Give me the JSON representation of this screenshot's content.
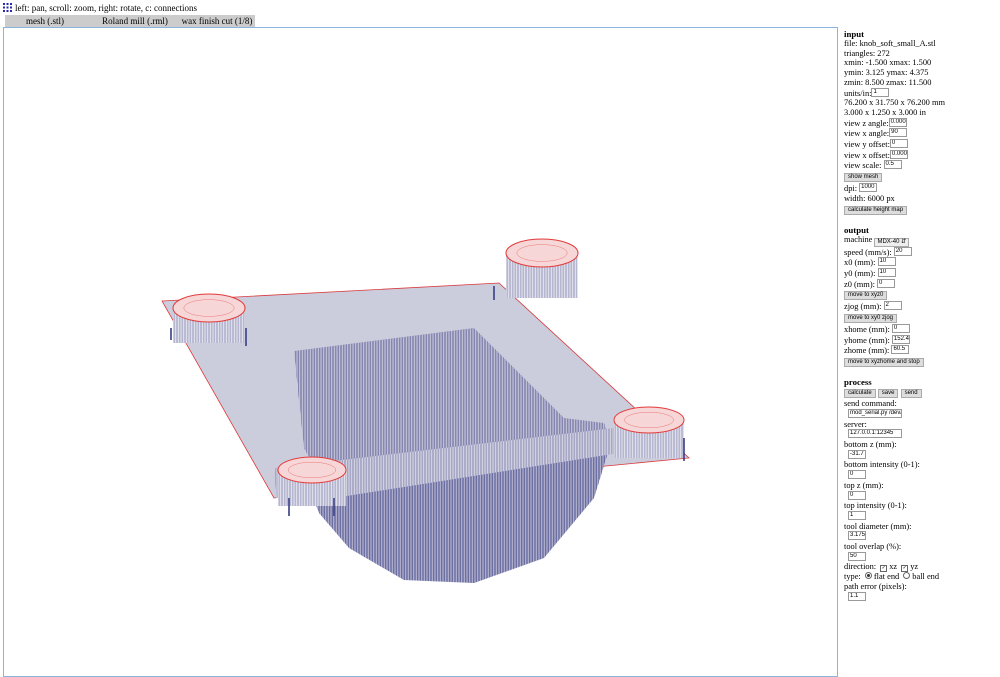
{
  "help": "left: pan, scroll: zoom, right: rotate, c: connections",
  "tabs": [
    "mesh (.stl)",
    "Roland mill (.rml)",
    "wax finish cut (1/8)"
  ],
  "input": {
    "title": "input",
    "file": "file: knob_soft_small_A.stl",
    "triangles": "triangles: 272",
    "xrange": "xmin: -1.500 xmax: 1.500",
    "yrange": "ymin: 3.125 ymax: 4.375",
    "zrange": "zmin: 8.500 zmax: 11.500",
    "units_label": "units/in:",
    "units_value": "1",
    "size_mm": "76.200 x 31.750 x 76.200 mm",
    "size_in": "3.000 x 1.250 x 3.000 in",
    "view_z_label": "view z angle:",
    "view_z": "0.000",
    "view_x_label": "view x angle:",
    "view_x": "90",
    "view_y_off_label": "view y offset:",
    "view_y_off": "0",
    "view_x_off_label": "view x offset:",
    "view_x_off": "0.000",
    "view_scale_label": "view scale:",
    "view_scale": "0.5",
    "show_mesh": "show mesh",
    "dpi_label": "dpi:",
    "dpi": "1000",
    "width": "width: 6000 px",
    "calc_height": "calculate height map"
  },
  "output": {
    "title": "output",
    "machine_label": "machine",
    "machine": "MDX-40",
    "speed_label": "speed (mm/s):",
    "speed": "20",
    "x0_label": "x0 (mm):",
    "x0": "10",
    "y0_label": "y0 (mm):",
    "y0": "10",
    "z0_label": "z0 (mm):",
    "z0": "0",
    "move_xyz0": "move to xyz0",
    "zjog_label": "zjog (mm):",
    "zjog": "2",
    "move_xy0": "move to xy0 zjog",
    "xhome_label": "xhome (mm):",
    "xhome": "0",
    "yhome_label": "yhome (mm):",
    "yhome": "152.4",
    "zhome_label": "zhome (mm):",
    "zhome": "60.5",
    "move_home": "move to xyzhome and stop"
  },
  "process": {
    "title": "process",
    "calculate": "calculate",
    "save": "save",
    "send": "send",
    "send_cmd_label": "send command:",
    "send_cmd": "mod_serial.py /dev/",
    "server_label": "server:",
    "server": "127.0.0.1:12345",
    "bottom_z_label": "bottom z (mm):",
    "bottom_z": "-31.7",
    "bottom_int_label": "bottom intensity (0-1):",
    "bottom_int": "0",
    "top_z_label": "top z (mm):",
    "top_z": "0",
    "top_int_label": "top intensity (0-1):",
    "top_int": "1",
    "tool_dia_label": "tool diameter (mm):",
    "tool_dia": "3.175",
    "tool_overlap_label": "tool overlap (%):",
    "tool_overlap": "50",
    "direction_label": "direction:",
    "dir_xz": "xz",
    "dir_yz": "yz",
    "type_label": "type:",
    "type_flat": "flat end",
    "type_ball": "ball end",
    "path_error_label": "path error (pixels):",
    "path_error": "1.1"
  },
  "colors": {
    "mesh_line": "#2b2e78",
    "toolpath": "#e23a3a",
    "view_border": "#88b4de"
  }
}
